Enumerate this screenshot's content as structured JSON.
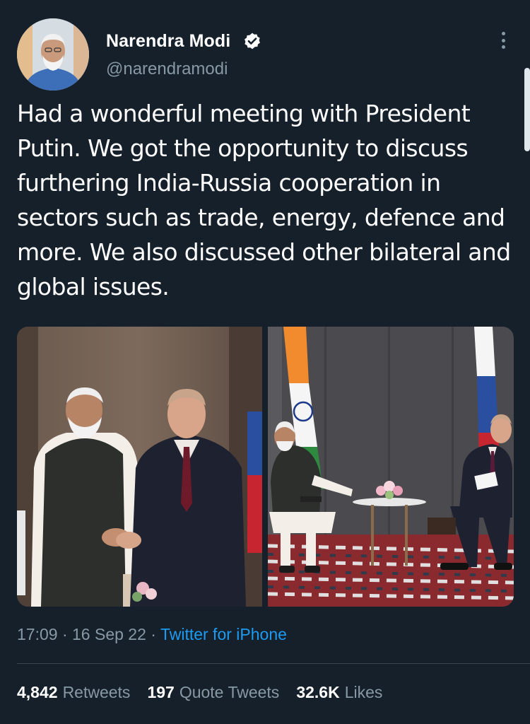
{
  "author": {
    "display_name": "Narendra Modi",
    "handle": "@narendramodi",
    "verified": true
  },
  "tweet": {
    "text": "Had a wonderful meeting with President Putin. We got the opportunity to discuss furthering India-Russia cooperation in sectors such as trade, energy, defence and more. We also discussed other bilateral and global issues.",
    "time": "17:09",
    "date": "16 Sep 22",
    "source": "Twitter for iPhone",
    "separator": "·"
  },
  "stats": {
    "retweets": {
      "count": "4,842",
      "label": "Retweets"
    },
    "quote_tweets": {
      "count": "197",
      "label": "Quote Tweets"
    },
    "likes": {
      "count": "32.6K",
      "label": "Likes"
    }
  },
  "icons": {
    "verified": "verified-badge-icon",
    "more": "more-vertical-icon"
  },
  "colors": {
    "background": "#15202b",
    "text_primary": "#ffffff",
    "text_secondary": "#8899a6",
    "link": "#1d9bf0",
    "divider": "#38444d"
  }
}
